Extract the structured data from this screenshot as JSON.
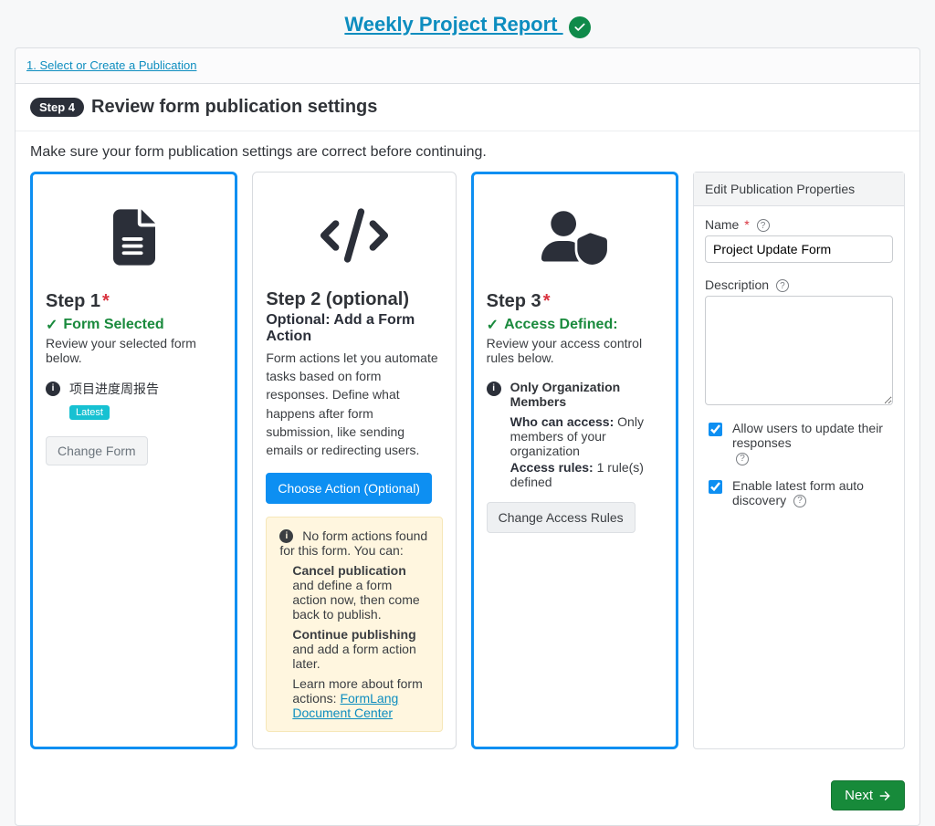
{
  "header": {
    "title": "Weekly Project Report "
  },
  "breadcrumb": {
    "item": "1. Select or Create a Publication"
  },
  "stepHeader": {
    "pill": "Step 4",
    "title": "Review form publication settings"
  },
  "instruction": "Make sure your form publication settings are correct before continuing.",
  "step1": {
    "label": "Step 1",
    "checkText": "Form Selected",
    "sub": "Review your selected form below.",
    "formName": "项目进度周报告",
    "latest": "Latest",
    "changeBtn": "Change Form"
  },
  "step2": {
    "label": "Step 2 (optional)",
    "subtitle": "Optional: Add a Form Action",
    "desc": "Form actions let you automate tasks based on form responses. Define what happens after form submission, like sending emails or redirecting users.",
    "chooseBtn": "Choose Action (Optional)",
    "alert": {
      "intro": "No form actions found for this form. You can:",
      "li1a": "Cancel publication",
      "li1b": " and define a form action now, then come back to publish.",
      "li2a": "Continue publishing",
      "li2b": " and add a form action later.",
      "learn": "Learn more about form actions: ",
      "link": "FormLang Document Center"
    }
  },
  "step3": {
    "label": "Step 3",
    "checkText": "Access Defined:",
    "sub": "Review your access control rules below.",
    "accessTitle": "Only Organization Members",
    "whoLabel": "Who can access:",
    "whoVal": " Only members of your organization",
    "rulesLabel": "Access rules:",
    "rulesVal": " 1 rule(s) defined",
    "changeBtn": "Change Access Rules"
  },
  "props": {
    "header": "Edit Publication Properties",
    "nameLabel": "Name",
    "nameValue": "Project Update Form",
    "descLabel": "Description",
    "descValue": "",
    "cb1": "Allow users to update their responses",
    "cb2": "Enable latest form auto discovery"
  },
  "footer": {
    "next": "Next"
  }
}
